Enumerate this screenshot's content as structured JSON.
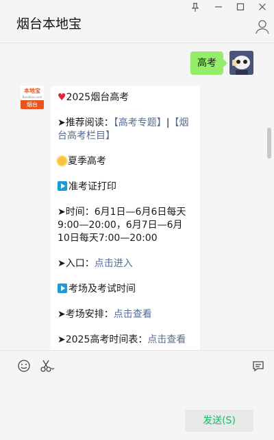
{
  "window": {
    "title": "烟台本地宝",
    "controls": {
      "pin_icon": "pin-icon",
      "minimize_icon": "minimize-icon",
      "maximize_icon": "maximize-icon",
      "close_icon": "close-icon"
    }
  },
  "outgoing": {
    "text": "高考"
  },
  "account": {
    "logo_text": "本地宝",
    "logo_sub": "Bendibao.com",
    "logo_city": "烟台"
  },
  "message": {
    "title": "2025烟台高考",
    "recommend_prefix": "➤推荐阅读：",
    "recommend_link1": "【高考专题】",
    "recommend_sep": "|",
    "recommend_link2": "【烟台高考栏目】",
    "summer": "夏季高考",
    "print_heading": "准考证打印",
    "time_label": "➤时间：6月1日—6月6日每天9:00—20:00，6月7日—6月10日每天7:00—20:00",
    "entry_prefix": "➤入口：",
    "entry_link": "点击进入",
    "venue_heading": "考场及考试时间",
    "arrange_prefix": "➤考场安排：",
    "arrange_link": "点击查看",
    "schedule_prefix": "➤2025高考时间表：",
    "schedule_link": "点击查看"
  },
  "input": {
    "send_label": "发送(S)"
  },
  "colors": {
    "outgoing_bubble": "#95ec69",
    "link": "#576b95",
    "send_text": "#07c160",
    "accent": "#e8541e"
  }
}
